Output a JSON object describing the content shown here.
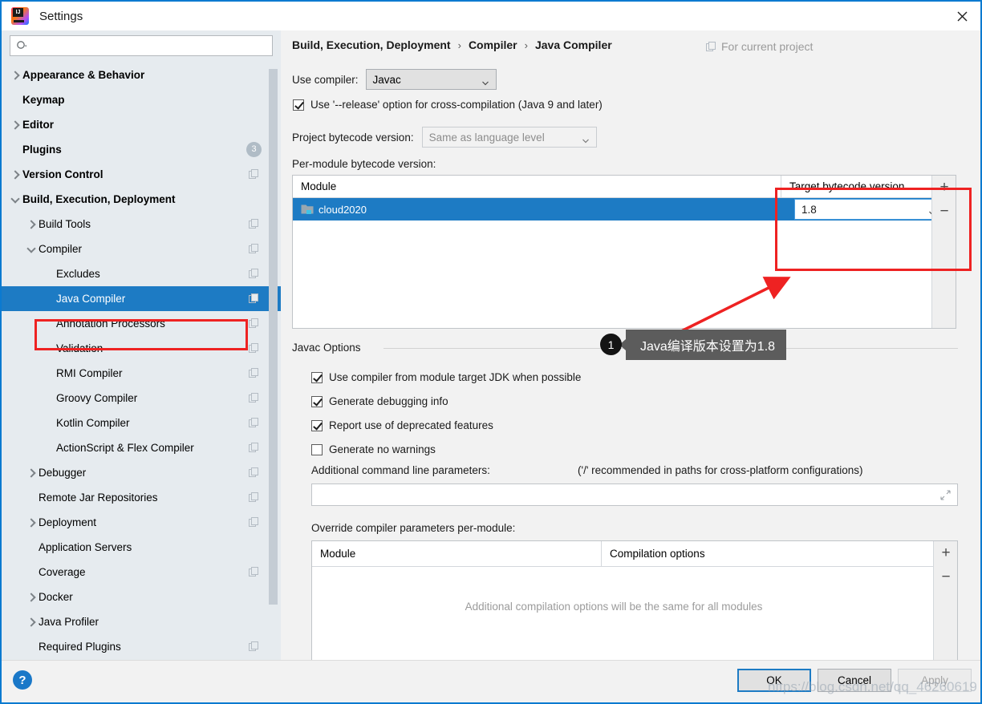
{
  "window": {
    "title": "Settings",
    "logo_icon": "intellij-idea-logo",
    "close_icon": "close-icon"
  },
  "sidebar": {
    "search": {
      "placeholder": "",
      "value": "",
      "icon": "search-icon"
    },
    "items": [
      {
        "label": "Appearance & Behavior",
        "indent": 0,
        "arrow": "right",
        "bold": true,
        "copy": false,
        "badge": null,
        "selected": false
      },
      {
        "label": "Keymap",
        "indent": 0,
        "arrow": "none",
        "bold": true,
        "copy": false,
        "badge": null,
        "selected": false
      },
      {
        "label": "Editor",
        "indent": 0,
        "arrow": "right",
        "bold": true,
        "copy": false,
        "badge": null,
        "selected": false
      },
      {
        "label": "Plugins",
        "indent": 0,
        "arrow": "none",
        "bold": true,
        "copy": false,
        "badge": "3",
        "selected": false
      },
      {
        "label": "Version Control",
        "indent": 0,
        "arrow": "right",
        "bold": true,
        "copy": true,
        "badge": null,
        "selected": false
      },
      {
        "label": "Build, Execution, Deployment",
        "indent": 0,
        "arrow": "down",
        "bold": true,
        "copy": false,
        "badge": null,
        "selected": false
      },
      {
        "label": "Build Tools",
        "indent": 1,
        "arrow": "right",
        "bold": false,
        "copy": true,
        "badge": null,
        "selected": false
      },
      {
        "label": "Compiler",
        "indent": 1,
        "arrow": "down",
        "bold": false,
        "copy": true,
        "badge": null,
        "selected": false
      },
      {
        "label": "Excludes",
        "indent": 2,
        "arrow": "none",
        "bold": false,
        "copy": true,
        "badge": null,
        "selected": false
      },
      {
        "label": "Java Compiler",
        "indent": 2,
        "arrow": "none",
        "bold": false,
        "copy": true,
        "badge": null,
        "selected": true
      },
      {
        "label": "Annotation Processors",
        "indent": 2,
        "arrow": "none",
        "bold": false,
        "copy": true,
        "badge": null,
        "selected": false
      },
      {
        "label": "Validation",
        "indent": 2,
        "arrow": "none",
        "bold": false,
        "copy": true,
        "badge": null,
        "selected": false
      },
      {
        "label": "RMI Compiler",
        "indent": 2,
        "arrow": "none",
        "bold": false,
        "copy": true,
        "badge": null,
        "selected": false
      },
      {
        "label": "Groovy Compiler",
        "indent": 2,
        "arrow": "none",
        "bold": false,
        "copy": true,
        "badge": null,
        "selected": false
      },
      {
        "label": "Kotlin Compiler",
        "indent": 2,
        "arrow": "none",
        "bold": false,
        "copy": true,
        "badge": null,
        "selected": false
      },
      {
        "label": "ActionScript & Flex Compiler",
        "indent": 2,
        "arrow": "none",
        "bold": false,
        "copy": true,
        "badge": null,
        "selected": false
      },
      {
        "label": "Debugger",
        "indent": 1,
        "arrow": "right",
        "bold": false,
        "copy": true,
        "badge": null,
        "selected": false
      },
      {
        "label": "Remote Jar Repositories",
        "indent": 1,
        "arrow": "none",
        "bold": false,
        "copy": true,
        "badge": null,
        "selected": false
      },
      {
        "label": "Deployment",
        "indent": 1,
        "arrow": "right",
        "bold": false,
        "copy": true,
        "badge": null,
        "selected": false
      },
      {
        "label": "Application Servers",
        "indent": 1,
        "arrow": "none",
        "bold": false,
        "copy": false,
        "badge": null,
        "selected": false
      },
      {
        "label": "Coverage",
        "indent": 1,
        "arrow": "none",
        "bold": false,
        "copy": true,
        "badge": null,
        "selected": false
      },
      {
        "label": "Docker",
        "indent": 1,
        "arrow": "right",
        "bold": false,
        "copy": false,
        "badge": null,
        "selected": false
      },
      {
        "label": "Java Profiler",
        "indent": 1,
        "arrow": "right",
        "bold": false,
        "copy": false,
        "badge": null,
        "selected": false
      },
      {
        "label": "Required Plugins",
        "indent": 1,
        "arrow": "none",
        "bold": false,
        "copy": true,
        "badge": null,
        "selected": false
      }
    ]
  },
  "main": {
    "breadcrumb": {
      "part1": "Build, Execution, Deployment",
      "sep1": "›",
      "part2": "Compiler",
      "sep2": "›",
      "part3": "Java Compiler"
    },
    "for_current_project": "For current project",
    "use_compiler_label": "Use compiler:",
    "use_compiler_value": "Javac",
    "release_option_label": "Use '--release' option for cross-compilation (Java 9 and later)",
    "release_option_checked": true,
    "project_bytecode_label": "Project bytecode version:",
    "project_bytecode_value": "Same as language level",
    "per_module_label": "Per-module bytecode version:",
    "module_table": {
      "col_module": "Module",
      "col_target": "Target bytecode version",
      "add_label": "+",
      "remove_label": "−",
      "rows": [
        {
          "module": "cloud2020",
          "target": "1.8",
          "selected": true
        }
      ]
    },
    "javac_options_title": "Javac Options",
    "javac_checkboxes": [
      {
        "label": "Use compiler from module target JDK when possible",
        "checked": true
      },
      {
        "label": "Generate debugging info",
        "checked": true
      },
      {
        "label": "Report use of deprecated features",
        "checked": true
      },
      {
        "label": "Generate no warnings",
        "checked": false
      }
    ],
    "additional_params_label": "Additional command line parameters:",
    "additional_params_hint": "('/' recommended in paths for cross-platform configurations)",
    "additional_params_value": "",
    "override_label": "Override compiler parameters per-module:",
    "override_table": {
      "col_module": "Module",
      "col_options": "Compilation options",
      "empty_note": "Additional compilation options will be the same for all modules",
      "add_label": "+",
      "remove_label": "−"
    }
  },
  "annotation": {
    "number": "1",
    "text": "Java编译版本设置为1.8",
    "box_color": "#ee2222",
    "arrow_color": "#ee2222"
  },
  "footer": {
    "help_label": "?",
    "ok_label": "OK",
    "cancel_label": "Cancel",
    "apply_label": "Apply"
  },
  "watermark": "https://blog.csdn.net/qq_46260619"
}
